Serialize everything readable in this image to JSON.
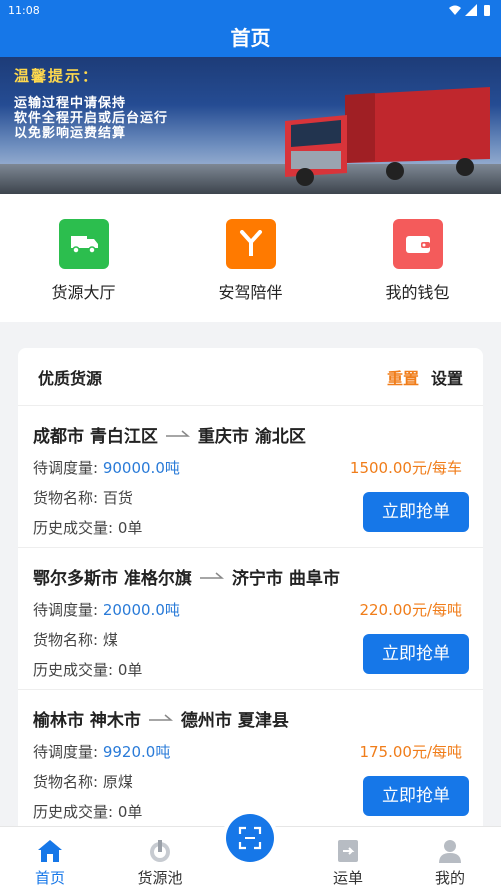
{
  "status": {
    "time": "11:08"
  },
  "header": {
    "title": "首页"
  },
  "banner": {
    "notice_title": "温馨提示：",
    "notice_lines": [
      "运输过程中请保持",
      "软件全程开启或后台运行",
      "以免影响运费结算"
    ]
  },
  "quick_menu": [
    {
      "label": "货源大厅",
      "icon": "truck-icon",
      "color": "#2cbe4e"
    },
    {
      "label": "安驾陪伴",
      "icon": "road-fork-icon",
      "color": "#ff7a00"
    },
    {
      "label": "我的钱包",
      "icon": "wallet-icon",
      "color": "#f45b5b"
    }
  ],
  "list": {
    "title": "优质货源",
    "reset_label": "重置",
    "settings_label": "设置",
    "qty_label": "待调度量:",
    "goods_label": "货物名称:",
    "history_label": "历史成交量:",
    "grab_label": "立即抢单",
    "items": [
      {
        "from": "成都市 青白江区",
        "to": "重庆市 渝北区",
        "qty": "90000.0吨",
        "price": "1500.00元/每车",
        "goods": "百货",
        "history": "0单"
      },
      {
        "from": "鄂尔多斯市 准格尔旗",
        "to": "济宁市 曲阜市",
        "qty": "20000.0吨",
        "price": "220.00元/每吨",
        "goods": "煤",
        "history": "0单"
      },
      {
        "from": "榆林市 神木市",
        "to": "德州市 夏津县",
        "qty": "9920.0吨",
        "price": "175.00元/每吨",
        "goods": "原煤",
        "history": "0单"
      }
    ]
  },
  "tabbar": {
    "tabs": [
      {
        "label": "首页",
        "icon": "home-icon",
        "active": true
      },
      {
        "label": "货源池",
        "icon": "power-icon"
      },
      {
        "label": "运单",
        "icon": "waybill-icon"
      },
      {
        "label": "我的",
        "icon": "user-icon"
      }
    ],
    "scan_icon": "scan-icon"
  },
  "colors": {
    "primary": "#1677e8",
    "accent": "#f07d1a"
  }
}
